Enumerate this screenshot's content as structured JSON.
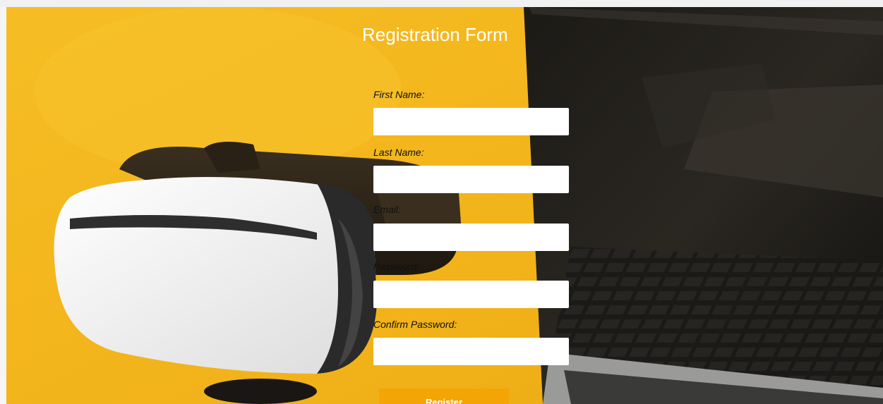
{
  "form": {
    "title": "Registration Form",
    "fields": [
      {
        "label": "First Name:",
        "value": ""
      },
      {
        "label": "Last Name:",
        "value": ""
      },
      {
        "label": "Email:",
        "value": ""
      },
      {
        "label": "Password:",
        "value": ""
      },
      {
        "label": "Confirm Password:",
        "value": ""
      }
    ],
    "submit_label": "Register"
  },
  "colors": {
    "background": "#f2b41a",
    "button": "#f5a405"
  }
}
